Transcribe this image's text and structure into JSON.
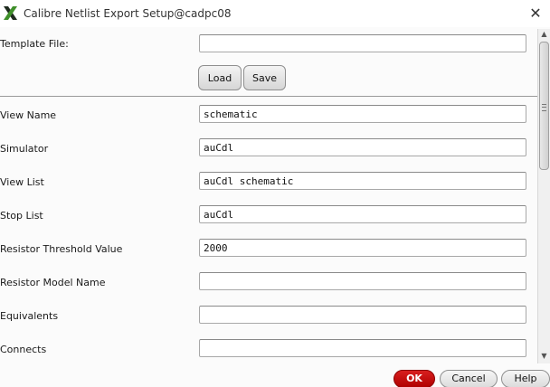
{
  "window": {
    "title": "Calibre Netlist Export Setup@cadpc08",
    "icon": "calibre-x-icon",
    "close_glyph": "✕"
  },
  "template": {
    "label": "Template File:",
    "value": "",
    "load_label": "Load",
    "save_label": "Save"
  },
  "fields": [
    {
      "label": "View Name",
      "value": "schematic"
    },
    {
      "label": "Simulator",
      "value": "auCdl"
    },
    {
      "label": "View List",
      "value": "auCdl schematic"
    },
    {
      "label": "Stop List",
      "value": "auCdl"
    },
    {
      "label": "Resistor Threshold Value",
      "value": "2000"
    },
    {
      "label": "Resistor Model Name",
      "value": ""
    },
    {
      "label": "Equivalents",
      "value": ""
    },
    {
      "label": "Connects",
      "value": ""
    }
  ],
  "footer": {
    "ok_label": "OK",
    "cancel_label": "Cancel",
    "help_label": "Help"
  },
  "colors": {
    "ok_button": "#c00000",
    "icon_green": "#3f8f2a",
    "icon_dark": "#1e2a1e"
  }
}
